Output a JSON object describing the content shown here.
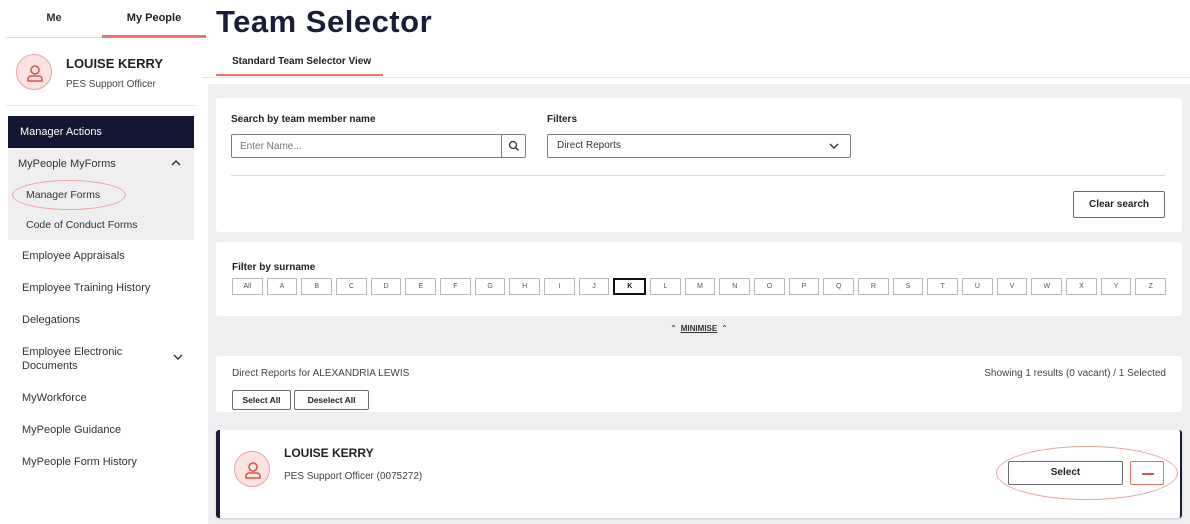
{
  "sidebar": {
    "tabs": {
      "me": "Me",
      "my_people": "My People"
    },
    "profile": {
      "name": "LOUISE KERRY",
      "role": "PES Support Officer"
    },
    "menu_head": "Manager Actions",
    "group": {
      "label": "MyPeople MyForms",
      "items": [
        "Manager Forms",
        "Code of Conduct Forms"
      ]
    },
    "items": [
      "Employee Appraisals",
      "Employee Training History",
      "Delegations",
      "Employee Electronic Documents",
      "MyWorkforce",
      "MyPeople Guidance",
      "MyPeople Form History"
    ]
  },
  "main": {
    "title": "Team Selector",
    "view_tab": "Standard Team Selector View",
    "search": {
      "label": "Search by team member name",
      "placeholder": "Enter Name...",
      "filters_label": "Filters",
      "filter_value": "Direct Reports",
      "clear_label": "Clear search"
    },
    "surname": {
      "label": "Filter by surname",
      "letters": [
        "All",
        "A",
        "B",
        "C",
        "D",
        "E",
        "F",
        "G",
        "H",
        "I",
        "J",
        "K",
        "L",
        "M",
        "N",
        "O",
        "P",
        "Q",
        "R",
        "S",
        "T",
        "U",
        "V",
        "W",
        "X",
        "Y",
        "Z"
      ],
      "selected": "K",
      "minimise": "MINIMISE"
    },
    "results": {
      "title": "Direct Reports for ALEXANDRIA LEWIS",
      "count": "Showing 1 results (0 vacant) / 1 Selected",
      "select_all": "Select All",
      "deselect_all": "Deselect All"
    },
    "person": {
      "name": "LOUISE KERRY",
      "role": "PES Support Officer (0075272)",
      "select_label": "Select"
    }
  },
  "colors": {
    "navy": "#131632",
    "accent": "#e8766c",
    "panel": "#efeff2"
  }
}
